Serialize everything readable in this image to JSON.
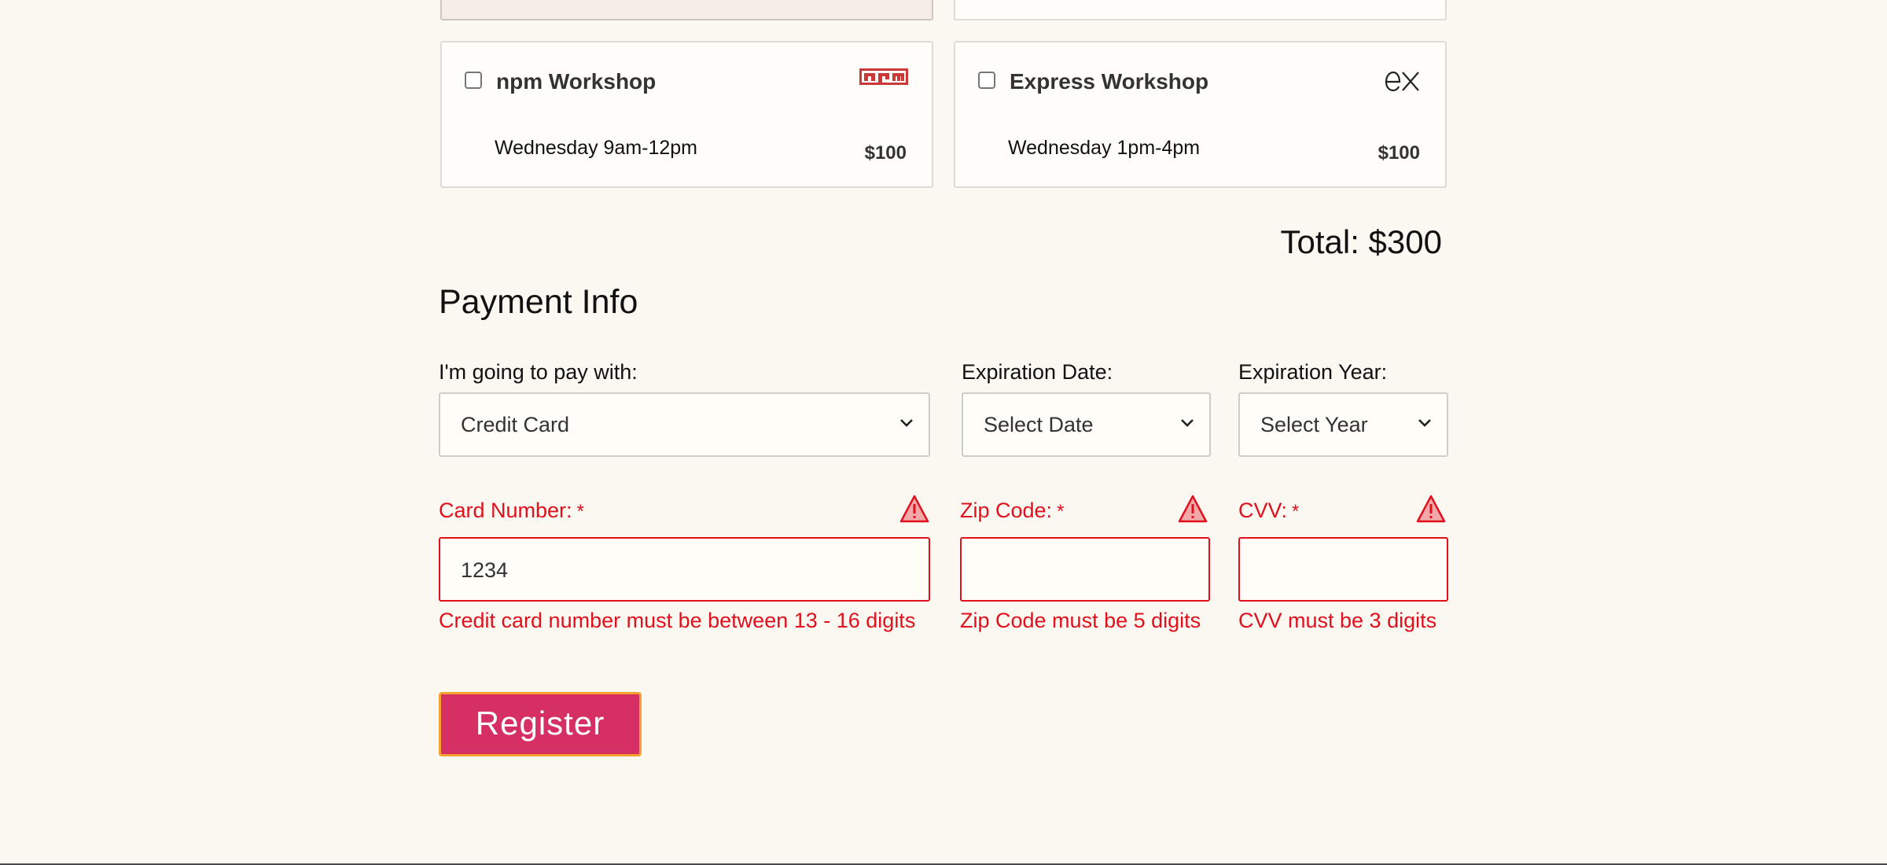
{
  "workshops": [
    {
      "name": "npm Workshop",
      "time": "Wednesday 9am-12pm",
      "price": "$100",
      "icon": "npm-logo-icon",
      "checked": false
    },
    {
      "name": "Express Workshop",
      "time": "Wednesday 1pm-4pm",
      "price": "$100",
      "icon": "express-logo-icon",
      "checked": false
    }
  ],
  "total": "Total: $300",
  "payment": {
    "title": "Payment Info",
    "pay_with": {
      "label": "I'm going to pay with:",
      "value": "Credit Card"
    },
    "exp_date": {
      "label": "Expiration Date:",
      "value": "Select Date"
    },
    "exp_year": {
      "label": "Expiration Year:",
      "value": "Select Year"
    },
    "card_number": {
      "label": "Card Number:",
      "value": "1234",
      "error": "Credit card number must be between 13 - 16 digits"
    },
    "zip": {
      "label": "Zip Code:",
      "value": "",
      "error": "Zip Code must be 5 digits"
    },
    "cvv": {
      "label": "CVV:",
      "value": "",
      "error": "CVV must be 3 digits"
    },
    "required_marker": "*"
  },
  "register_label": "Register",
  "colors": {
    "error": "#e0101d",
    "button": "#d62f63",
    "button_border": "#f3a230",
    "background": "#fbf7f1"
  }
}
